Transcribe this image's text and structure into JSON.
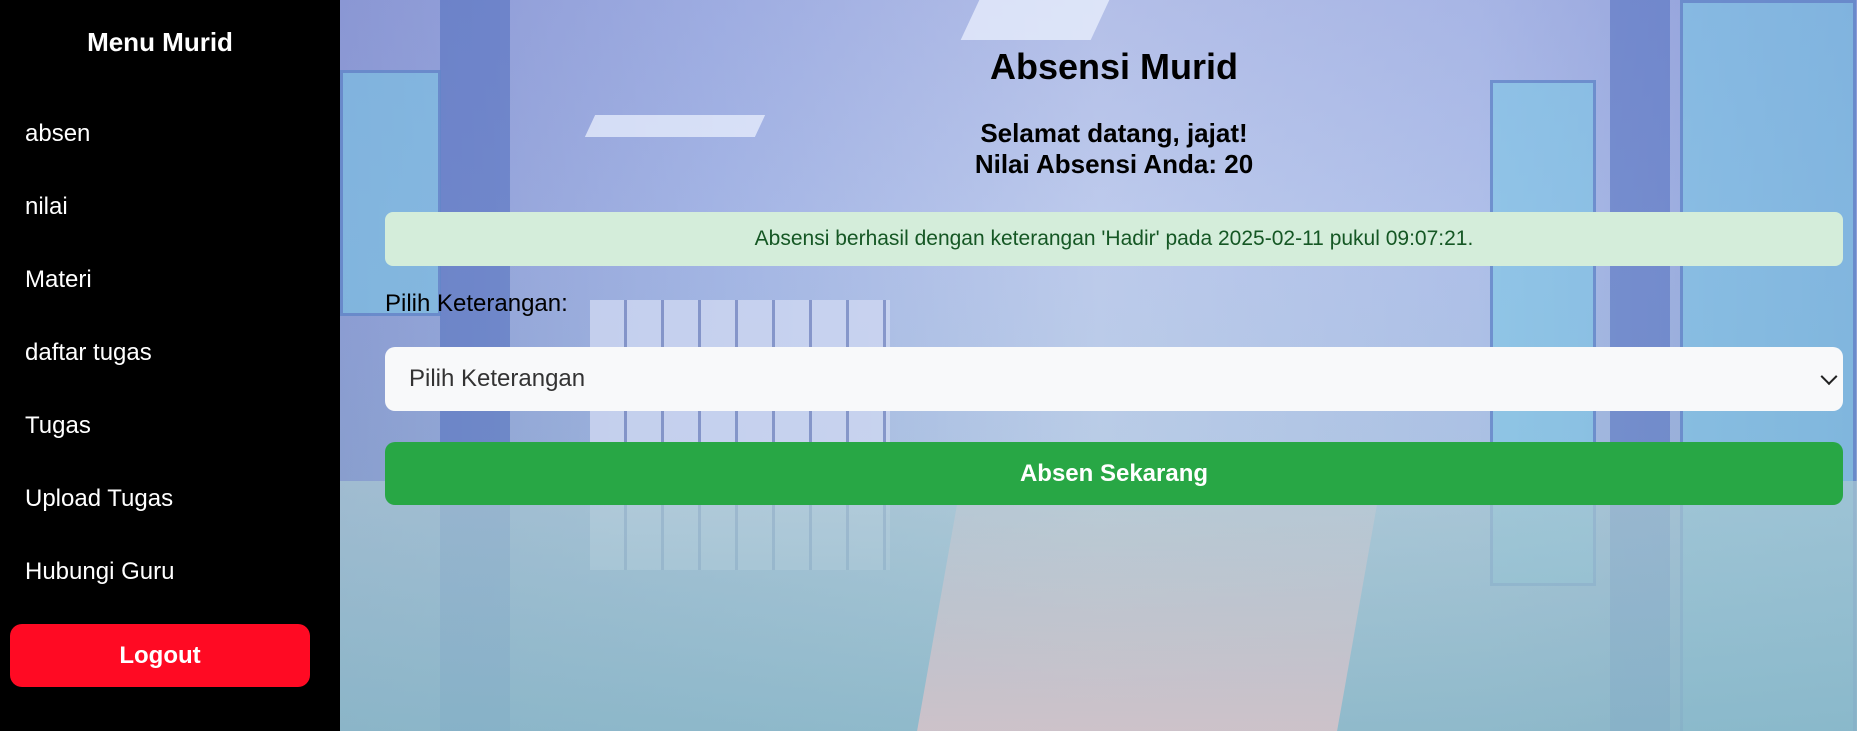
{
  "sidebar": {
    "title": "Menu Murid",
    "items": [
      {
        "label": "absen"
      },
      {
        "label": "nilai"
      },
      {
        "label": "Materi"
      },
      {
        "label": "daftar tugas"
      },
      {
        "label": "Tugas"
      },
      {
        "label": "Upload Tugas"
      },
      {
        "label": "Hubungi Guru"
      }
    ],
    "logout_label": "Logout"
  },
  "main": {
    "title": "Absensi Murid",
    "welcome_line1": "Selamat datang, jajat!",
    "welcome_line2": "Nilai Absensi Anda: 20",
    "alert_text": "Absensi berhasil dengan keterangan 'Hadir' pada 2025-02-11 pukul 09:07:21.",
    "select_label": "Pilih Keterangan:",
    "select_value": "Pilih Keterangan",
    "submit_label": "Absen Sekarang"
  },
  "colors": {
    "sidebar_bg": "#000000",
    "logout_bg": "#ff0a23",
    "alert_bg": "#d4edda",
    "alert_text": "#155724",
    "submit_bg": "#28a745"
  }
}
